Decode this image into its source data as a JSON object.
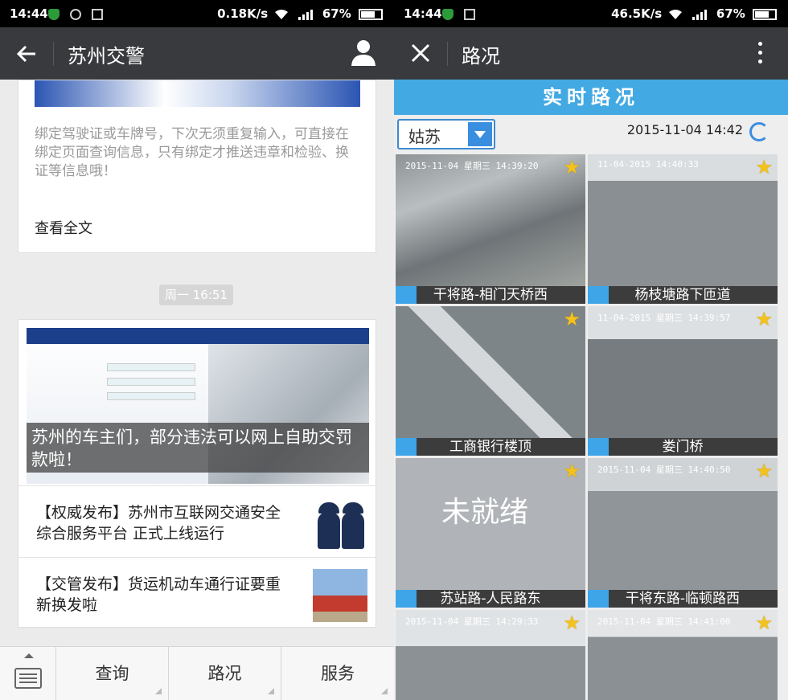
{
  "left": {
    "status": {
      "time": "14:44",
      "speed": "0.18K/s",
      "network": "4G",
      "battery": "67%"
    },
    "title": "苏州交警",
    "article": {
      "desc": "绑定驾驶证或车牌号，下次无须重复输入，可直接在绑定页面查询信息，只有绑定才推送违章和检验、换证等信息哦！",
      "more": "查看全文"
    },
    "time_chip": "周一 16:51",
    "feature": {
      "caption": "苏州的车主们，部分违法可以网上自助交罚款啦！"
    },
    "news": [
      {
        "title": "【权威发布】苏州市互联网交通安全综合服务平台 正式上线运行"
      },
      {
        "title": "【交管发布】货运机动车通行证要重新换发啦"
      }
    ],
    "menu": [
      "查询",
      "路况",
      "服务"
    ]
  },
  "right": {
    "status": {
      "time": "14:44",
      "speed": "46.5K/s",
      "network": "4G",
      "battery": "67%"
    },
    "title": "路况",
    "banner": "实时路况",
    "area": "姑苏",
    "datetime": "2015-11-04 14:42",
    "cameras": [
      {
        "label": "干将路-相门天桥西",
        "ts": "2015-11-04 星期三 14:39:20"
      },
      {
        "label": "杨枝塘路下匝道",
        "ts": "11-04-2015 14:40:33"
      },
      {
        "label": "工商银行楼顶",
        "ts": ""
      },
      {
        "label": "娄门桥",
        "ts": "11-04-2015 星期三 14:39:57"
      },
      {
        "label": "苏站路-人民路东",
        "ts": "",
        "status": "未就绪"
      },
      {
        "label": "干将东路-临顿路西",
        "ts": "2015-11-04 星期三 14:40:50"
      },
      {
        "label": "",
        "ts": "2015-11-04 星期三 14:29:33"
      },
      {
        "label": "",
        "ts": "2015-11-04 星期三 14:41:00"
      }
    ]
  }
}
